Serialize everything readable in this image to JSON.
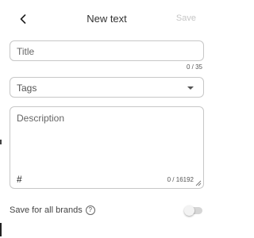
{
  "header": {
    "title": "New text",
    "save_label": "Save",
    "back_icon": "chevron-left-icon"
  },
  "form": {
    "title_placeholder": "Title",
    "title_value": "",
    "title_counter": "0 / 35",
    "tags_label": "Tags",
    "tags_caret_icon": "chevron-down-icon",
    "description_placeholder": "Description",
    "description_value": "",
    "hash_label": "#",
    "description_counter": "0 / 16192"
  },
  "footer": {
    "save_for_brands_label": "Save for all brands",
    "help_icon_glyph": "?",
    "toggle_on": false
  },
  "colors": {
    "save_disabled": "#c6c6c6",
    "border": "#c7c7c7",
    "toggle_track": "#d6d6d6"
  }
}
